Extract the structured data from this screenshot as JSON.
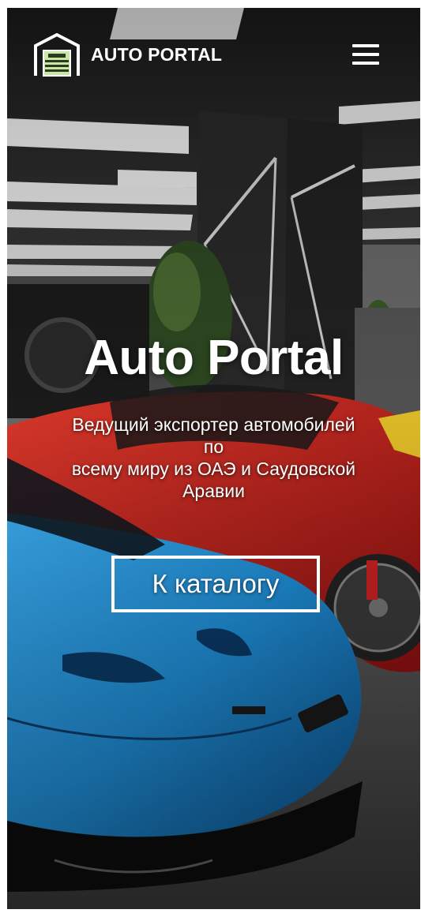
{
  "header": {
    "brand": "AUTO PORTAL",
    "logo_icon": "garage-icon",
    "menu_icon": "hamburger-menu-icon"
  },
  "hero": {
    "title": "Auto Portal",
    "subtitle_lines": [
      "Ведущий экспортер автомобилей",
      "по",
      "всему миру из ОАЭ и Саудовской",
      "Аравии"
    ],
    "cta_label": "К каталогу"
  },
  "colors": {
    "text": "#ffffff",
    "logo_fill": "#c8e6a5",
    "car_blue": "#1f8fd8",
    "car_red": "#c81f1f"
  }
}
